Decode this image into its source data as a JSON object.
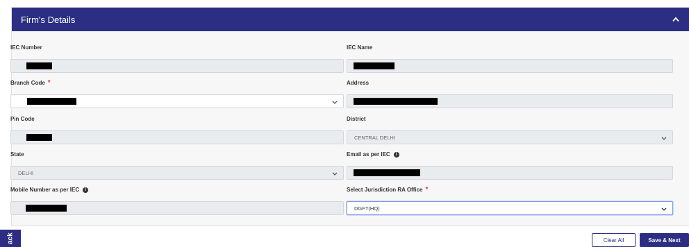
{
  "panel": {
    "title": "Firm's Details"
  },
  "fields": {
    "iec_number": {
      "label": "IEC Number"
    },
    "iec_name": {
      "label": "IEC Name"
    },
    "branch_code": {
      "label": "Branch Code",
      "required": "*"
    },
    "address": {
      "label": "Address"
    },
    "pin_code": {
      "label": "Pin Code"
    },
    "district": {
      "label": "District",
      "value": "CENTRAL DELHI"
    },
    "state": {
      "label": "State",
      "value": "DELHI"
    },
    "email": {
      "label": "Email as per IEC"
    },
    "mobile": {
      "label": "Mobile Number as per IEC"
    },
    "jurisdiction": {
      "label": "Select Jurisdiction RA Office",
      "required": "*",
      "value": "DGFT(HQ)"
    }
  },
  "buttons": {
    "clear": "Clear All",
    "save": "Save & Next"
  },
  "feedback": {
    "label": "ack"
  },
  "colors": {
    "primary": "#2b2e83",
    "required": "#e53935"
  }
}
